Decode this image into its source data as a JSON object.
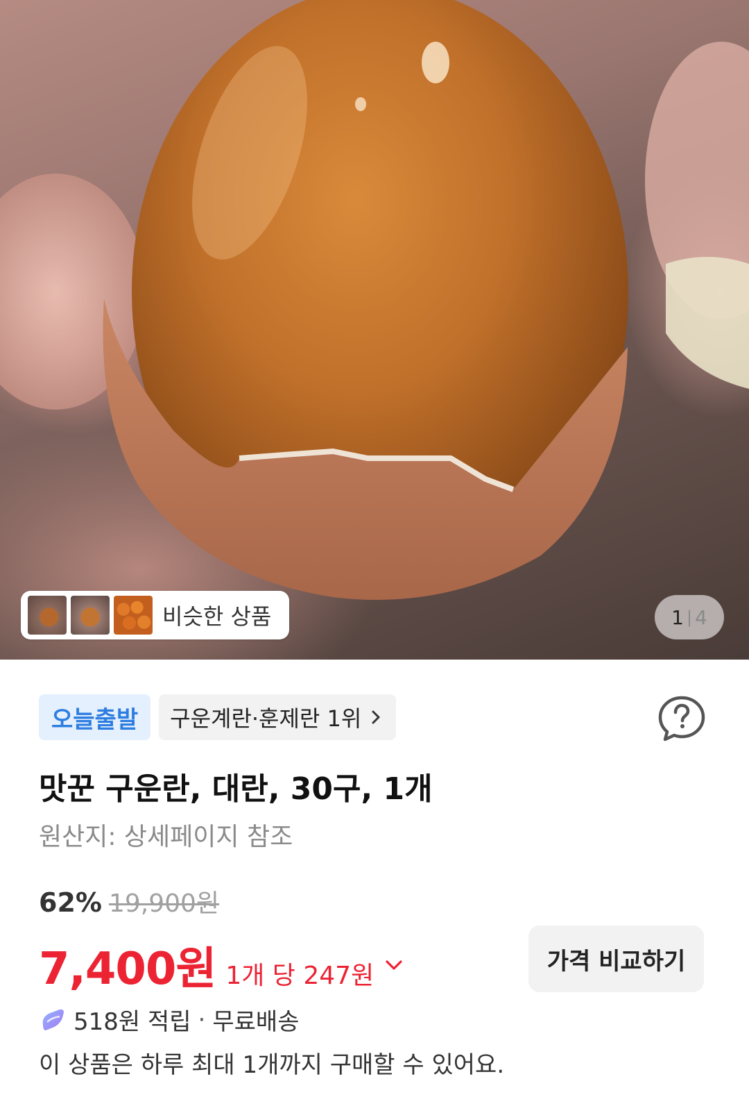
{
  "gallery": {
    "similar_label": "비슷한 상품",
    "current": "1",
    "total": "4",
    "thumbnails": [
      "thumb-smoked-egg-1",
      "thumb-smoked-egg-2",
      "thumb-smoked-eggs-pile"
    ]
  },
  "badges": {
    "today": "오늘출발",
    "rank": "구운계란·훈제란 1위"
  },
  "product": {
    "title": "맛꾼 구운란, 대란, 30구, 1개",
    "origin": "원산지: 상세페이지 참조"
  },
  "price": {
    "discount_rate": "62%",
    "original": "19,900원",
    "sale": "7,400원",
    "unit": "1개 당 247원",
    "compare_button": "가격 비교하기"
  },
  "benefits": {
    "reward": "518원 적립",
    "separator": "·",
    "shipping": "무료배송",
    "limit_note": "이 상품은 하루 최대 1개까지 구매할 수 있어요."
  },
  "colors": {
    "accent_red": "#ec2333",
    "today_badge_text": "#2e7de1",
    "today_badge_bg": "#e4f0fd"
  }
}
